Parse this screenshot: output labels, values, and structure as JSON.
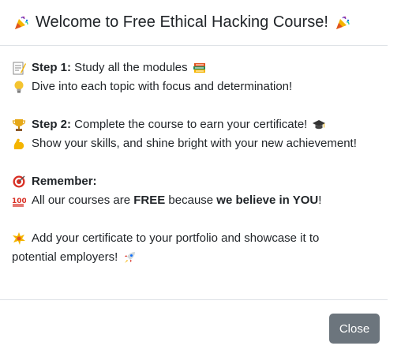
{
  "header": {
    "title": "Welcome to Free Ethical Hacking Course!",
    "leading_icon": "party-popper-icon",
    "trailing_icon": "party-popper-icon"
  },
  "body": {
    "step1": {
      "label": "Step 1:",
      "text": " Study all the modules",
      "icon": "memo-icon",
      "trailing_icon": "books-icon"
    },
    "step1_detail": {
      "text": "Dive into each topic with focus and determination!",
      "icon": "light-bulb-icon"
    },
    "step2": {
      "label": "Step 2:",
      "text": " Complete the course to earn your certificate!",
      "icon": "trophy-icon",
      "trailing_icon": "graduation-cap-icon"
    },
    "step2_detail": {
      "text": "Show your skills, and shine bright with your new achievement!",
      "icon": "flexed-biceps-icon"
    },
    "remember": {
      "label": "Remember:",
      "icon": "direct-hit-icon"
    },
    "remember_detail": {
      "text_before": "All our courses are ",
      "free": "FREE",
      "text_middle": " because ",
      "believe": "we believe in YOU",
      "text_after": "!",
      "icon": "hundred-points-icon"
    },
    "portfolio": {
      "text_line1": "Add your certificate to your portfolio and showcase it to",
      "text_line2": "potential employers!",
      "icon": "collision-icon",
      "trailing_icon": "rocket-icon"
    }
  },
  "footer": {
    "close_label": "Close"
  },
  "colors": {
    "close_button_bg": "#6c757d",
    "divider": "#dee2e6",
    "text": "#212529"
  }
}
